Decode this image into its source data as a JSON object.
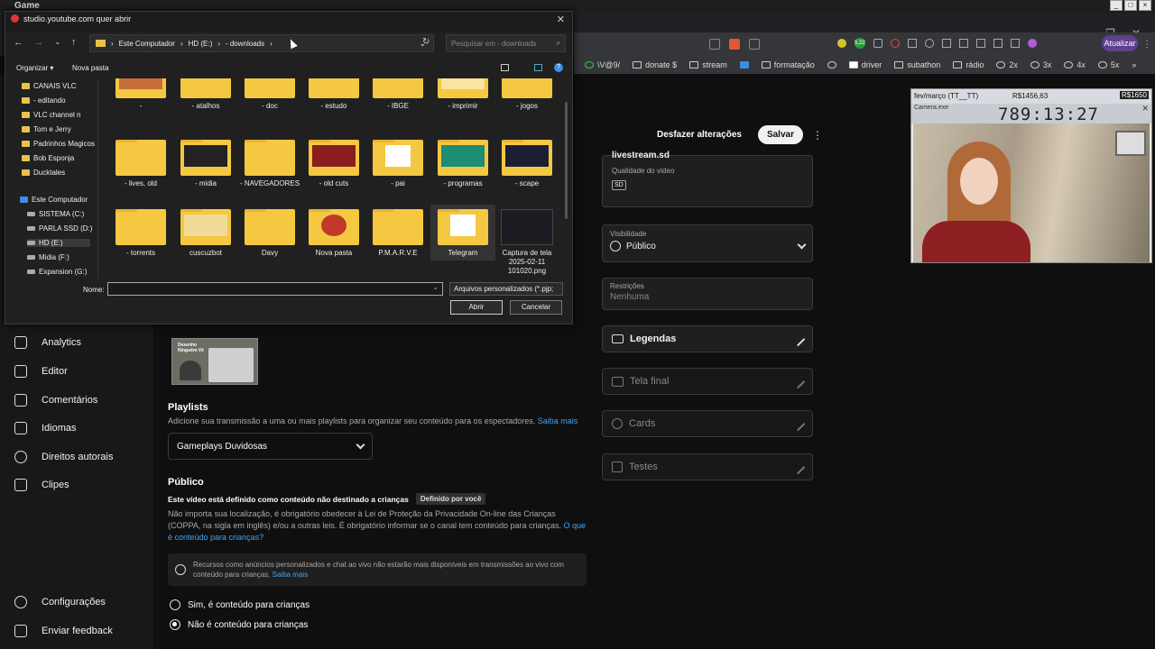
{
  "os": {
    "title": "Game"
  },
  "browser": {
    "update_btn": "Atualizar",
    "ext_badge": "5,22",
    "bookmarks": [
      "\\V@9/",
      "donate $",
      "stream",
      "",
      "formatação",
      "",
      "driver",
      "subathon",
      "rádio",
      "2x",
      "3x",
      "4x",
      "5x"
    ]
  },
  "dialog": {
    "title": "studio.youtube.com quer abrir",
    "breadcrumb": [
      "Este Computador",
      "HD (E:)",
      "- downloads"
    ],
    "search_placeholder": "Pesquisar em - downloads",
    "organize": "Organizar",
    "new_folder": "Nova pasta",
    "tree": [
      {
        "label": "CANAIS VLC",
        "type": "folder"
      },
      {
        "label": "- editando",
        "type": "folder"
      },
      {
        "label": "VLC channel n",
        "type": "folder"
      },
      {
        "label": "Tom e Jerry",
        "type": "folder"
      },
      {
        "label": "Padrinhos Magicos",
        "type": "folder"
      },
      {
        "label": "Bob Esponja",
        "type": "folder"
      },
      {
        "label": "Ducktales",
        "type": "folder"
      },
      {
        "label": "Este Computador",
        "type": "pc"
      },
      {
        "label": "SISTEMA (C:)",
        "type": "drive"
      },
      {
        "label": "PARLA SSD (D:)",
        "type": "drive"
      },
      {
        "label": "HD (E:)",
        "type": "drive"
      },
      {
        "label": "Midia (F:)",
        "type": "drive"
      },
      {
        "label": "Expansion (G:)",
        "type": "drive"
      }
    ],
    "rows": [
      [
        "-",
        "- atalhos",
        "- doc",
        "- estudo",
        "- IBGE",
        "- imprimir",
        "- jogos"
      ],
      [
        "- lives, old",
        "- midia",
        "- NAVEGADORES",
        "- old cuts",
        "- pai",
        "- programas",
        "- scape"
      ],
      [
        "- torrents",
        "cuscuzbot",
        "Davy",
        "Nova pasta",
        "P.M.A.R.V.E",
        "Telegram",
        "Captura de tela 2025-02-11 101020.png"
      ]
    ],
    "name_label": "Nome:",
    "name_value": "",
    "file_type": "Arquivos personalizados (*.pjp;",
    "open_btn": "Abrir",
    "cancel_btn": "Cancelar"
  },
  "studio": {
    "sidebar": [
      "Analytics",
      "Editor",
      "Comentários",
      "Idiomas",
      "Direitos autorais",
      "Clipes",
      "Configurações",
      "Enviar feedback"
    ],
    "undo": "Desfazer alterações",
    "save": "Salvar",
    "stream_label": "livestream.sd",
    "quality_label": "Qualidade do vídeo",
    "quality_value": "SD",
    "visibility_label": "Visibilidade",
    "visibility_value": "Público",
    "restrictions_label": "Restrições",
    "restrictions_value": "Nenhuma",
    "legendas": "Legendas",
    "tela_final": "Tela final",
    "cards": "Cards",
    "testes": "Testes",
    "thumb_text": "Desenho Ninguém Vê",
    "playlists_title": "Playlists",
    "playlists_desc": "Adicione sua transmissão a uma ou mais playlists para organizar seu conteúdo para os espectadores.",
    "saiba_mais": "Saiba mais",
    "playlist_value": "Gameplays Duvidosas",
    "publico_title": "Público",
    "kids_status": "Este vídeo está definido como conteúdo não destinado a crianças",
    "kids_badge": "Definido por você",
    "coppa_text": "Não importa sua localização, é obrigatório obedecer à Lei de Proteção da Privacidade On-line das Crianças (COPPA, na sigla em inglês) e/ou a outras leis. É obrigatório informar se o canal tem conteúdo para crianças.",
    "coppa_link": "O que é conteúdo para crianças?",
    "info_text": "Recursos como anúncios personalizados e chat ao vivo não estarão mais disponíveis em transmissões ao vivo com conteúdo para crianças.",
    "info_link": "Saiba mais",
    "radio_yes": "Sim, é conteúdo para crianças",
    "radio_no": "Não é conteúdo para crianças"
  },
  "overlay": {
    "month_label": "fev/março (TT__TT)",
    "money1": "R$1456,63",
    "money2": "R$1650",
    "camera_title": "Camera.exe",
    "clock": "789:13:27"
  }
}
